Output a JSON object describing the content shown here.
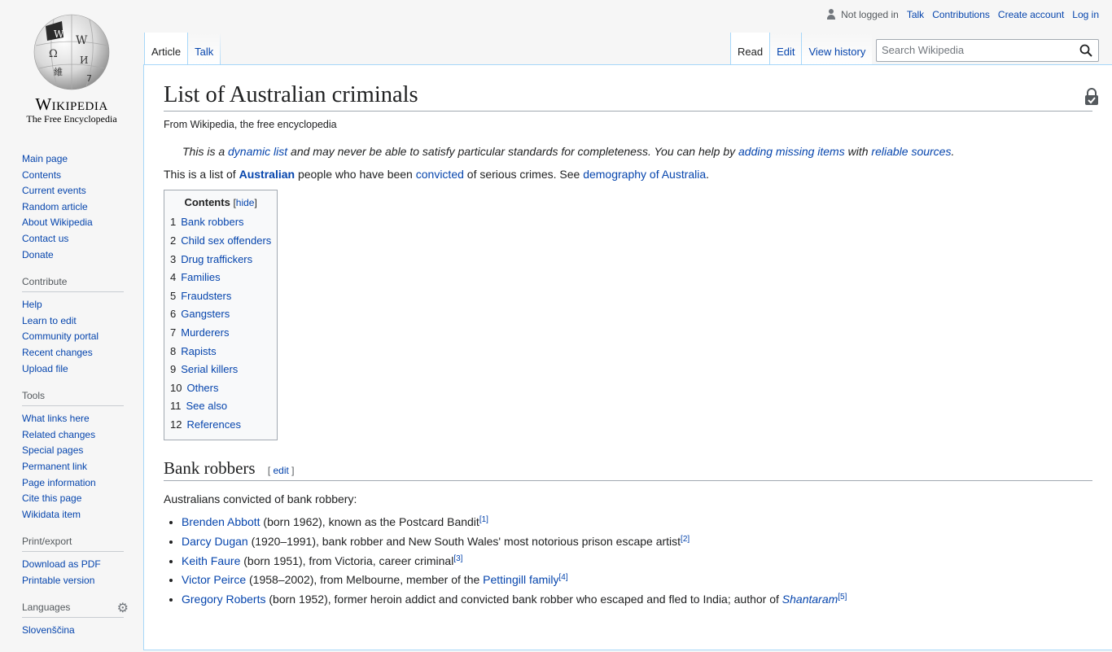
{
  "logo": {
    "wordmark": "Wikipedia",
    "tagline": "The Free Encyclopedia"
  },
  "sidebar": {
    "navigation": [
      "Main page",
      "Contents",
      "Current events",
      "Random article",
      "About Wikipedia",
      "Contact us",
      "Donate"
    ],
    "contribute": {
      "heading": "Contribute",
      "items": [
        "Help",
        "Learn to edit",
        "Community portal",
        "Recent changes",
        "Upload file"
      ]
    },
    "tools": {
      "heading": "Tools",
      "items": [
        "What links here",
        "Related changes",
        "Special pages",
        "Permanent link",
        "Page information",
        "Cite this page",
        "Wikidata item"
      ]
    },
    "print": {
      "heading": "Print/export",
      "items": [
        "Download as PDF",
        "Printable version"
      ]
    },
    "languages": {
      "heading": "Languages",
      "items": [
        "Slovenščina"
      ]
    }
  },
  "personal": {
    "not_logged_in": "Not logged in",
    "talk": "Talk",
    "contributions": "Contributions",
    "create_account": "Create account",
    "log_in": "Log in"
  },
  "tabs": {
    "article": "Article",
    "talk": "Talk",
    "read": "Read",
    "edit": "Edit",
    "history": "View history"
  },
  "search": {
    "placeholder": "Search Wikipedia"
  },
  "article": {
    "title": "List of Australian criminals",
    "sitesub": "From Wikipedia, the free encyclopedia",
    "hatnote": {
      "t1": "This is a ",
      "l1": "dynamic list",
      "t2": " and may never be able to satisfy particular standards for completeness. You can help by ",
      "l2": "adding missing items",
      "t3": " with ",
      "l3": "reliable sources",
      "t4": "."
    },
    "intro": {
      "t1": "This is a list of ",
      "l1": "Australian",
      "t2": " people who have been ",
      "l2": "convicted",
      "t3": " of serious crimes. See ",
      "l3": "demography of Australia",
      "t4": "."
    },
    "toc": {
      "title": "Contents",
      "hide": "hide",
      "items": [
        {
          "num": "1",
          "label": "Bank robbers"
        },
        {
          "num": "2",
          "label": "Child sex offenders"
        },
        {
          "num": "3",
          "label": "Drug traffickers"
        },
        {
          "num": "4",
          "label": "Families"
        },
        {
          "num": "5",
          "label": "Fraudsters"
        },
        {
          "num": "6",
          "label": "Gangsters"
        },
        {
          "num": "7",
          "label": "Murderers"
        },
        {
          "num": "8",
          "label": "Rapists"
        },
        {
          "num": "9",
          "label": "Serial killers"
        },
        {
          "num": "10",
          "label": "Others"
        },
        {
          "num": "11",
          "label": "See also"
        },
        {
          "num": "12",
          "label": "References"
        }
      ]
    },
    "section": {
      "heading": "Bank robbers",
      "edit": "edit",
      "intro": "Australians convicted of bank robbery:",
      "entries": [
        {
          "name": "Brenden Abbott",
          "desc": " (born 1962), known as the Postcard Bandit",
          "ref": "[1]"
        },
        {
          "name": "Darcy Dugan",
          "desc": " (1920–1991), bank robber and New South Wales' most notorious prison escape artist",
          "ref": "[2]"
        },
        {
          "name": "Keith Faure",
          "desc": " (born 1951), from Victoria, career criminal",
          "ref": "[3]"
        },
        {
          "name": "Victor Peirce",
          "desc": " (1958–2002), from Melbourne, member of the ",
          "link2": "Pettingill family",
          "ref": "[4]"
        },
        {
          "name": "Gregory Roberts",
          "desc": " (born 1952), former heroin addict and convicted bank robber who escaped and fled to India; author of ",
          "italic": "Shantaram",
          "ref": "[5]"
        }
      ]
    }
  }
}
